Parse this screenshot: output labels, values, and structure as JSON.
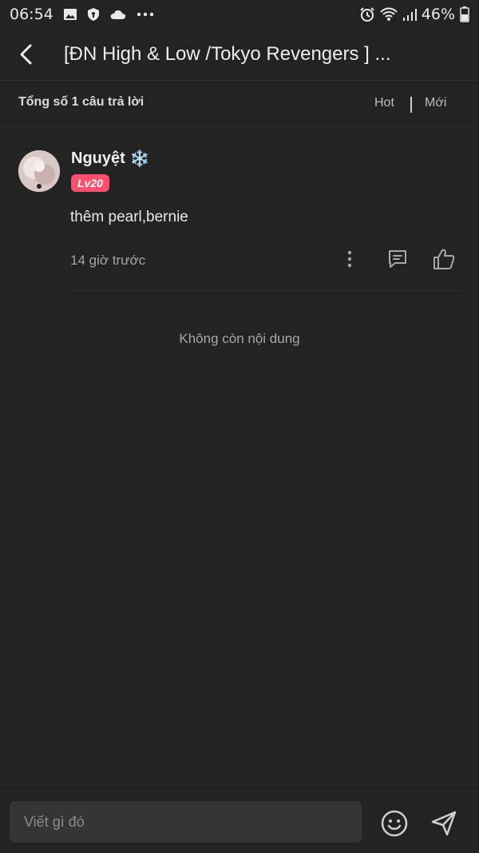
{
  "status_bar": {
    "time": "06:54",
    "battery": "46%",
    "icons": [
      "image-icon",
      "shield-icon",
      "cloud-icon",
      "more-dots-icon",
      "alarm-icon",
      "wifi-icon",
      "signal-icon",
      "battery-icon"
    ]
  },
  "header": {
    "title": "[ĐN High & Low /Tokyo Revengers ] ...",
    "back_icon": "chevron-left-icon"
  },
  "sortbar": {
    "total_label": "Tổng số 1 câu trả lời",
    "sort_hot": "Hot",
    "sort_new": "Mới"
  },
  "comments": [
    {
      "username": "Nguyệt",
      "username_emoji": "❄️",
      "level": "Lv20",
      "text": "thêm pearl,bernie",
      "time": "14 giờ trước"
    }
  ],
  "list_end_text": "Không còn nội dung",
  "composer": {
    "placeholder": "Viết gì đó"
  },
  "colors": {
    "background": "#232323",
    "level_badge": "#ff4f6c",
    "text_primary": "#e8e8e8",
    "text_secondary": "#a6a6a6"
  }
}
